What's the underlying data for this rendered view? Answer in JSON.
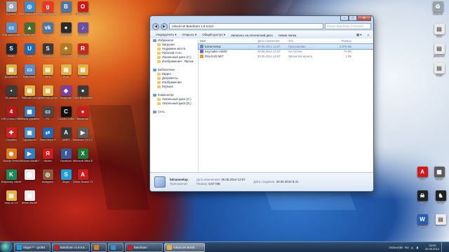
{
  "desktop_left_icons": [
    {
      "label": "Корзина",
      "color": "#9aa4ad",
      "glyph": "♻"
    },
    {
      "label": "Моё-мягко-сетевой",
      "color": "#2f8fd8",
      "glyph": "◎"
    },
    {
      "label": "Google Chrome",
      "color": "#e23b2e",
      "glyph": "g"
    },
    {
      "label": "ВКонтакте",
      "color": "#4a76a8",
      "glyph": "В"
    },
    {
      "label": "Ярлык Opera",
      "color": "#cc1a1a",
      "glyph": "O"
    },
    {
      "label": "Мой компьютер",
      "color": "#5b8fc9",
      "glyph": "▭"
    },
    {
      "label": "Ярлык игры",
      "color": "#4b6b2f",
      "glyph": "▲"
    },
    {
      "label": "VK",
      "color": "#4a76a8",
      "glyph": "vk"
    },
    {
      "label": "Bandicam",
      "color": "#2b2b2b",
      "glyph": "●"
    },
    {
      "label": "Музыка",
      "color": "#6b4fa0",
      "glyph": "♪"
    },
    {
      "label": "Steam",
      "color": "#1b2838",
      "glyph": "S"
    },
    {
      "label": "Uplay",
      "color": "#1f6ab8",
      "glyph": "U"
    },
    {
      "label": "SoundMax",
      "color": "#3a3a3a",
      "glyph": "S"
    },
    {
      "label": "CS Source",
      "color": "#b07a22",
      "glyph": "✦"
    },
    {
      "label": "RcWoods",
      "color": "#c52a1e",
      "glyph": "R"
    },
    {
      "label": "Документы",
      "color": "#d8b24a",
      "glyph": "▤"
    },
    {
      "label": "Компьютер",
      "color": "#5b8fc9",
      "glyph": "▭"
    },
    {
      "label": "Читы",
      "color": "#e0b248",
      "glyph": "▤"
    },
    {
      "label": "Игры",
      "color": "#e0b248",
      "glyph": "▤"
    },
    {
      "label": "Папка",
      "color": "#e0b248",
      "glyph": "▤"
    },
    {
      "label": "28-window",
      "color": "#3b3b3b",
      "glyph": "▪"
    },
    {
      "label": "Рабочий стол",
      "color": "#e0b248",
      "glyph": "▤"
    },
    {
      "label": "Диспетчер устройств",
      "color": "#e0b248",
      "glyph": "▤"
    },
    {
      "label": "Imaginary",
      "color": "#7b3fa0",
      "glyph": "◆"
    },
    {
      "label": "Open Broadcaster",
      "color": "#3a3a3a",
      "glyph": "●"
    },
    {
      "label": "Left 4 Dead 2 Beta",
      "color": "#b01a1a",
      "glyph": "4"
    },
    {
      "label": "Панель управления",
      "color": "#2f7fc8",
      "glyph": "▦"
    },
    {
      "label": "PC",
      "color": "#4a4a4a",
      "glyph": "▭"
    },
    {
      "label": "Counter-Strike",
      "color": "#111",
      "glyph": "C"
    },
    {
      "label": "Bandicam",
      "color": "#c81e1e",
      "glyph": "●"
    },
    {
      "label": "Cheatfish",
      "color": "#d02020",
      "glyph": "✚"
    },
    {
      "label": "Скриншоты",
      "color": "#3b8fd0",
      "glyph": "▣"
    },
    {
      "label": "TeamViewer 9",
      "color": "#1f6ab8",
      "glyph": "⇄"
    },
    {
      "label": "AIMP3",
      "color": "#3a3a3a",
      "glyph": "A"
    },
    {
      "label": "bandicam 2014-05-30",
      "color": "#5f5f5f",
      "glyph": "▶"
    },
    {
      "label": "Mozilla Firefox",
      "color": "#e07a1a",
      "glyph": "◉"
    },
    {
      "label": "Windows Media Player",
      "color": "#2f7fc8",
      "glyph": "▶"
    },
    {
      "label": "Yandex",
      "color": "#d01a1a",
      "glyph": "Я"
    },
    {
      "label": "Facebook",
      "color": "#3b5998",
      "glyph": "f"
    },
    {
      "label": "Microsoft Office Exc.",
      "color": "#1f7a3a",
      "glyph": "X"
    },
    {
      "label": "Kaspersky Internet Se.",
      "color": "#1a8a5a",
      "glyph": "K"
    },
    {
      "label": "",
      "color": "#e8e8e8",
      "glyph": "▤"
    },
    {
      "label": "Instagram",
      "color": "#8a5a3a",
      "glyph": "◎"
    },
    {
      "label": "Skype",
      "color": "#1aa0e0",
      "glyph": "S"
    },
    {
      "label": "Adobe Reader XI",
      "color": "#c81e1e",
      "glyph": "A"
    },
    {
      "label": "читы cs 1.6",
      "color": "#e0b248",
      "glyph": "▤"
    },
    {
      "label": "delete this file",
      "color": "#e8e8e8",
      "glyph": "▤"
    }
  ],
  "desktop_right_icons": [
    {
      "label": "Корзина",
      "color": "#9aa4ad",
      "glyph": "♻"
    },
    {
      "label": "Мой",
      "color": "#eaeaea",
      "glyph": "▤"
    },
    {
      "label": "Документ",
      "color": "#eaeaea",
      "glyph": "▤"
    },
    {
      "label": "Файл",
      "color": "#eaeaea",
      "glyph": "▤"
    },
    {
      "label": "AGT",
      "color": "#d01a1a",
      "glyph": "A"
    },
    {
      "label": "Ярлык",
      "color": "#5b5b5b",
      "glyph": "▦"
    },
    {
      "label": "Skull",
      "color": "#222",
      "glyph": "☠"
    },
    {
      "label": "Ghost",
      "color": "#222",
      "glyph": "♞"
    },
    {
      "label": "Word",
      "color": "#2a5db0",
      "glyph": "W"
    },
    {
      "label": "",
      "color": "#eaeaea",
      "glyph": "▤"
    }
  ],
  "explorer": {
    "address": "rolsod.net Bandicam 1.9.5.510",
    "search_placeholder": "Поиск: Bandicam 1.9.5.510",
    "toolbar": {
      "organize": "Упорядочить ▾",
      "open": "Открыть ▾",
      "share": "Общий доступ ▾",
      "burn": "Записать на оптический диск",
      "newfolder": "Новая папка"
    },
    "nav_tree": [
      {
        "label": "Избранное",
        "sub": false
      },
      {
        "label": "Загрузки",
        "sub": true
      },
      {
        "label": "Недавние места",
        "sub": true
      },
      {
        "label": "Рабочий стол",
        "sub": true
      },
      {
        "label": "Локальный диск (С:)",
        "sub": true
      },
      {
        "label": "Изображения - Ярлык",
        "sub": true
      },
      {
        "label": "",
        "sub": false
      },
      {
        "label": "Библиотеки",
        "sub": false
      },
      {
        "label": "Видео",
        "sub": true
      },
      {
        "label": "Документы",
        "sub": true
      },
      {
        "label": "Изображения",
        "sub": true
      },
      {
        "label": "Музыка",
        "sub": true
      },
      {
        "label": "",
        "sub": false
      },
      {
        "label": "Компьютер",
        "sub": false
      },
      {
        "label": "Локальный диск (С:)",
        "sub": true
      },
      {
        "label": "Локальный диск (D:)",
        "sub": true
      },
      {
        "label": "",
        "sub": false
      },
      {
        "label": "Сеть",
        "sub": false
      }
    ],
    "columns": {
      "name": "Имя",
      "date": "Дата изменения",
      "type": "Тип",
      "size": "Размер"
    },
    "files": [
      {
        "name": "bdcamsetup",
        "date": "30.05.2014 12:57",
        "type": "Приложение",
        "size": "8 875 КБ",
        "selected": true,
        "color": "#5a8fd0"
      },
      {
        "name": "Keymaker-AMZE",
        "date": "30.05.2014 12:57",
        "type": "rar Archive",
        "size": "70 КБ",
        "selected": false,
        "color": "#8a5ad0"
      },
      {
        "name": "RSLOAD.NET",
        "date": "30.05.2014 12:57",
        "type": "Ярлык Интернета",
        "size": "1 КБ",
        "selected": false,
        "color": "#e0a030"
      }
    ],
    "details": {
      "name": "bdcamsetup",
      "type": "Приложение",
      "modified_key": "Дата изменения:",
      "modified": "30.05.2014 12:57",
      "created_key": "Дата создания:",
      "created": "23.06.2014 6:41",
      "size_key": "Размер:",
      "size": "8,67 МБ"
    }
  },
  "taskbar": {
    "buttons": [
      {
        "label": "Skype™ - grol94",
        "color": "#1aa0e0",
        "active": false
      },
      {
        "label": "Bandicam v1.9.5.5...",
        "color": "#c81e1e",
        "active": false
      },
      {
        "label": "",
        "color": "#e07a1a",
        "active": false
      },
      {
        "label": "",
        "color": "#3b8fd0",
        "active": false
      },
      {
        "label": "Bandicam",
        "color": "#c81e1e",
        "active": false
      },
      {
        "label": "rolsod.net Bandi...",
        "color": "#e0b248",
        "active": true
      }
    ],
    "tray_text": "1920x1080",
    "clock_time": "13:03",
    "clock_date": "30.05.2014",
    "lang": "RU"
  }
}
